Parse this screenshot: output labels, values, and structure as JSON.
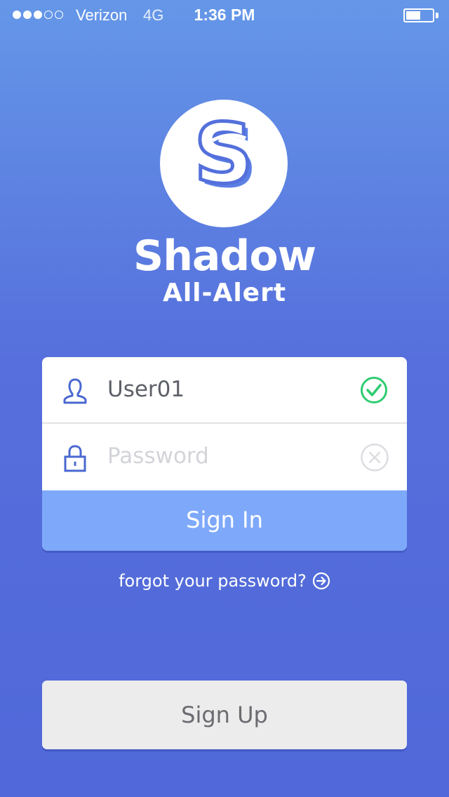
{
  "status_bar": {
    "carrier": "Verizon",
    "network": "4G",
    "time": "1:36 PM",
    "signal_bars_filled": 3,
    "signal_bars_total": 5,
    "battery_level": 0.55
  },
  "logo": {
    "icon": "shadow-s-logo",
    "name": "Shadow",
    "subtitle": "All-Alert"
  },
  "login_form": {
    "username": {
      "value": "User01",
      "icon": "user-icon",
      "status": "valid",
      "status_icon": "check-circle-icon"
    },
    "password": {
      "placeholder": "Password",
      "icon": "lock-icon",
      "status_icon": "clear-circle-icon"
    },
    "sign_in_label": "Sign In"
  },
  "forgot_password": {
    "label": "forgot your password?",
    "icon": "arrow-right-circle-icon"
  },
  "sign_up_label": "Sign Up",
  "colors": {
    "background_top": "#6597e8",
    "background_bottom": "#5068d9",
    "primary_button": "#7ea9fa",
    "icon_accent": "#4a68d0",
    "valid_green": "#2ecc71",
    "secondary_button": "#ececed"
  }
}
